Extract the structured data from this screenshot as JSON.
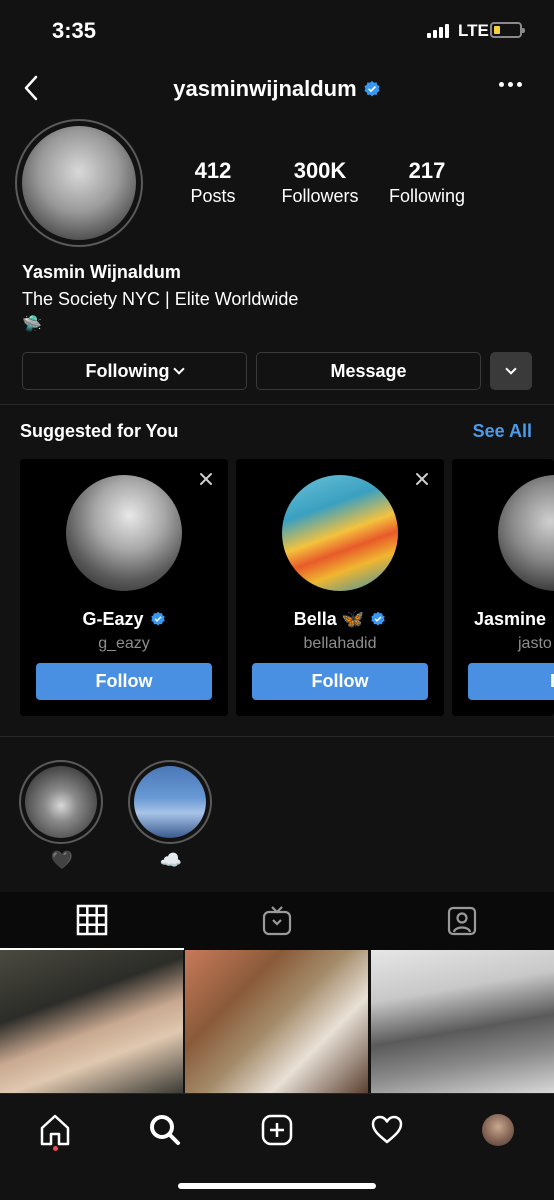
{
  "status_bar": {
    "time": "3:35",
    "network": "LTE"
  },
  "header": {
    "username": "yasminwijnaldum",
    "back_icon": "chevron-left-icon",
    "more_icon": "ellipsis-icon"
  },
  "stats": [
    {
      "value": "412",
      "label": "Posts"
    },
    {
      "value": "300K",
      "label": "Followers"
    },
    {
      "value": "217",
      "label": "Following"
    }
  ],
  "bio": {
    "name": "Yasmin Wijnaldum",
    "line": "The Society NYC | Elite Worldwide",
    "emoji": "🛸"
  },
  "actions": {
    "following_label": "Following",
    "message_label": "Message"
  },
  "suggested": {
    "title": "Suggested for You",
    "see_all": "See All",
    "follow_label": "Follow",
    "cards": [
      {
        "name": "G-Eazy",
        "handle": "g_eazy",
        "verified": true
      },
      {
        "name": "Bella 🦋",
        "handle": "bellahadid",
        "verified": true
      },
      {
        "name": "Jasmine",
        "handle": "jasto",
        "verified": false
      }
    ]
  },
  "highlights": [
    {
      "caption": "🖤"
    },
    {
      "caption": "☁️"
    }
  ],
  "colors": {
    "accent": "#4a90e2",
    "link": "#4a9be9",
    "verified": "#3897f0",
    "background": "#121212",
    "card": "#000000",
    "notification_dot": "#ed4956"
  },
  "tabs": [
    "grid-icon",
    "igtv-icon",
    "tagged-icon"
  ],
  "nav": [
    "home-icon",
    "search-icon",
    "new-post-icon",
    "activity-heart-icon",
    "profile-avatar"
  ]
}
